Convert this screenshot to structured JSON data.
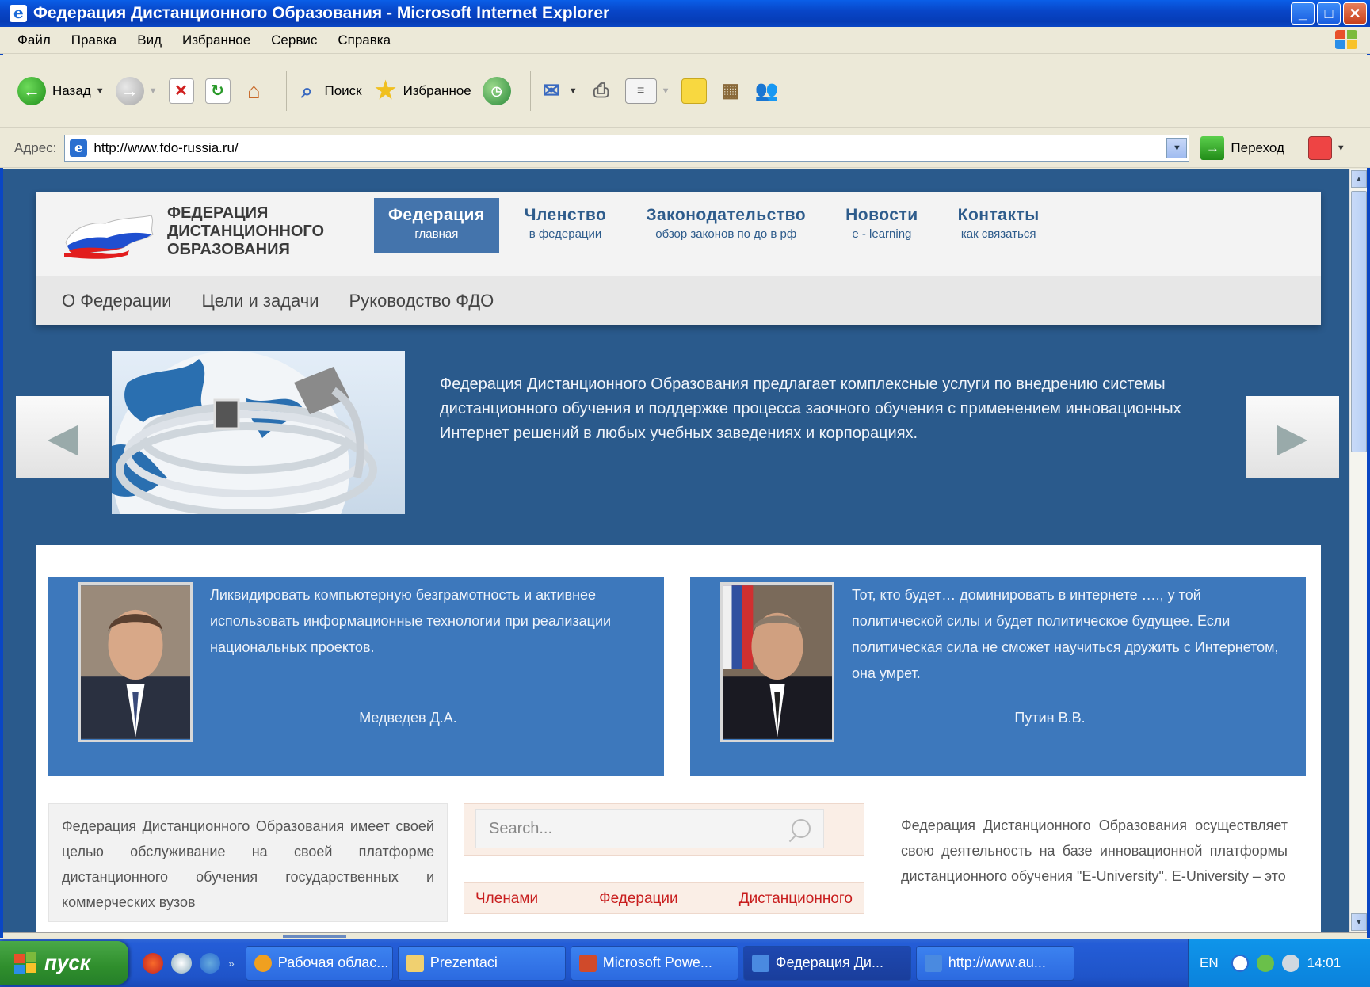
{
  "window": {
    "title": "Федерация Дистанционного Образования - Microsoft Internet Explorer"
  },
  "menu": [
    "Файл",
    "Правка",
    "Вид",
    "Избранное",
    "Сервис",
    "Справка"
  ],
  "toolbar": {
    "back_label": "Назад",
    "search_label": "Поиск",
    "favorites_label": "Избранное"
  },
  "address": {
    "label": "Адрес:",
    "url": "http://www.fdo-russia.ru/",
    "go_label": "Переход"
  },
  "site": {
    "logo_lines": [
      "ФЕДЕРАЦИЯ",
      "ДИСТАНЦИОННОГО",
      "ОБРАЗОВАНИЯ"
    ],
    "nav": [
      {
        "title": "Федерация",
        "sub": "главная",
        "active": true
      },
      {
        "title": "Членство",
        "sub": "в федерации"
      },
      {
        "title": "Законодательство",
        "sub": "обзор законов по до в рф"
      },
      {
        "title": "Новости",
        "sub": "e - learning"
      },
      {
        "title": "Контакты",
        "sub": "как связаться"
      }
    ],
    "subnav": [
      "О Федерации",
      "Цели и задачи",
      "Руководство ФДО"
    ],
    "slide_text": "Федерация Дистанционного Образования предлагает комплексные услуги по внедрению системы дистанционного обучения и поддержке процесса заочного обучения с применением инновационных Интернет решений в любых учебных заведениях и корпорациях.",
    "quotes": [
      {
        "text": "Ликвидировать компьютерную безграмотность и активнее использовать информационные технологии при реализации национальных проектов.",
        "author": "Медведев Д.А."
      },
      {
        "text": "Тот, кто будет… доминировать в интернете …., у той политической силы и будет политическое будущее. Если политическая сила не сможет научиться дружить с Интернетом, она умрет.",
        "author": "Путин В.В."
      }
    ],
    "left_col_text": "Федерация Дистанционного Образования имеет своей целью обслуживание на своей платформе дистанционного обучения государственных и коммерческих вузов",
    "search_placeholder": "Search...",
    "members_bar": [
      "Членами",
      "Федерации",
      "Дистанционного"
    ],
    "right_col_text": "Федерация Дистанционного Образования осуществляет свою деятельность на базе инновационной платформы дистанционного обучения \"E-University\". E-University – это"
  },
  "taskbar": {
    "start_label": "пуск",
    "tasks": [
      {
        "label": "Рабочая облас...",
        "icon": "folder-icon"
      },
      {
        "label": "Prezentaci",
        "icon": "folder-icon"
      },
      {
        "label": "Microsoft Powe...",
        "icon": "powerpoint-icon"
      },
      {
        "label": "Федерация Ди...",
        "icon": "ie-icon",
        "active": true
      },
      {
        "label": "http://www.au...",
        "icon": "ie-icon"
      }
    ],
    "lang": "EN",
    "clock": "14:01"
  },
  "colors": {
    "page_bg": "#2a5a8c",
    "nav_active": "#4474ac",
    "quote_bg": "#3d78bc",
    "members_text": "#c81e1e"
  }
}
